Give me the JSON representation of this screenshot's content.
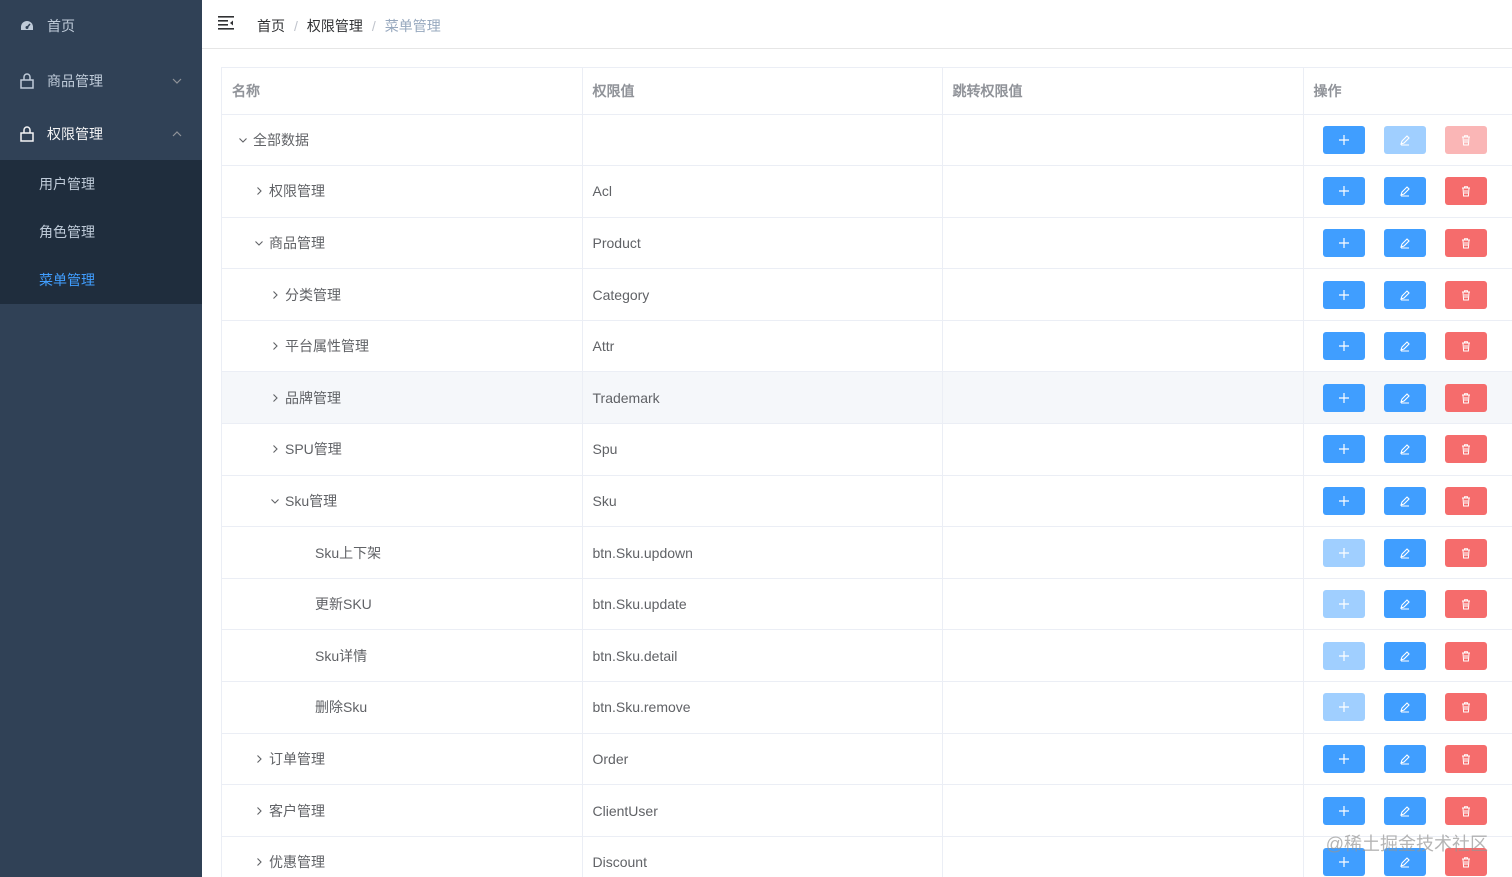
{
  "sidebar": {
    "items": [
      {
        "label": "首页",
        "icon": "dashboard-icon"
      },
      {
        "label": "商品管理",
        "icon": "lock-icon",
        "expanded": false
      },
      {
        "label": "权限管理",
        "icon": "lock-icon",
        "expanded": true
      }
    ],
    "submenu": [
      {
        "label": "用户管理",
        "active": false
      },
      {
        "label": "角色管理",
        "active": false
      },
      {
        "label": "菜单管理",
        "active": true
      }
    ],
    "colors": {
      "bg": "#304156",
      "sub_bg": "#1f2d3d",
      "text": "#bfcbd9",
      "active": "#409eff"
    }
  },
  "header": {
    "breadcrumb": [
      "首页",
      "权限管理",
      "菜单管理"
    ]
  },
  "table": {
    "columns": [
      "名称",
      "权限值",
      "跳转权限值",
      "操作"
    ],
    "rows": [
      {
        "name": "全部数据",
        "code": "",
        "toCode": "",
        "level": 0,
        "expand": "open",
        "addDisabled": false,
        "editDisabled": true,
        "delDisabled": true
      },
      {
        "name": "权限管理",
        "code": "Acl",
        "toCode": "",
        "level": 1,
        "expand": "closed",
        "addDisabled": false,
        "editDisabled": false,
        "delDisabled": false
      },
      {
        "name": "商品管理",
        "code": "Product",
        "toCode": "",
        "level": 1,
        "expand": "open",
        "addDisabled": false,
        "editDisabled": false,
        "delDisabled": false
      },
      {
        "name": "分类管理",
        "code": "Category",
        "toCode": "",
        "level": 2,
        "expand": "closed",
        "addDisabled": false,
        "editDisabled": false,
        "delDisabled": false
      },
      {
        "name": "平台属性管理",
        "code": "Attr",
        "toCode": "",
        "level": 2,
        "expand": "closed",
        "addDisabled": false,
        "editDisabled": false,
        "delDisabled": false
      },
      {
        "name": "品牌管理",
        "code": "Trademark",
        "toCode": "",
        "level": 2,
        "expand": "closed",
        "addDisabled": false,
        "editDisabled": false,
        "delDisabled": false,
        "hover": true
      },
      {
        "name": "SPU管理",
        "code": "Spu",
        "toCode": "",
        "level": 2,
        "expand": "closed",
        "addDisabled": false,
        "editDisabled": false,
        "delDisabled": false
      },
      {
        "name": "Sku管理",
        "code": "Sku",
        "toCode": "",
        "level": 2,
        "expand": "open",
        "addDisabled": false,
        "editDisabled": false,
        "delDisabled": false
      },
      {
        "name": "Sku上下架",
        "code": "btn.Sku.updown",
        "toCode": "",
        "level": 3,
        "expand": "none",
        "addDisabled": true,
        "editDisabled": false,
        "delDisabled": false
      },
      {
        "name": "更新SKU",
        "code": "btn.Sku.update",
        "toCode": "",
        "level": 3,
        "expand": "none",
        "addDisabled": true,
        "editDisabled": false,
        "delDisabled": false
      },
      {
        "name": "Sku详情",
        "code": "btn.Sku.detail",
        "toCode": "",
        "level": 3,
        "expand": "none",
        "addDisabled": true,
        "editDisabled": false,
        "delDisabled": false
      },
      {
        "name": "删除Sku",
        "code": "btn.Sku.remove",
        "toCode": "",
        "level": 3,
        "expand": "none",
        "addDisabled": true,
        "editDisabled": false,
        "delDisabled": false
      },
      {
        "name": "订单管理",
        "code": "Order",
        "toCode": "",
        "level": 1,
        "expand": "closed",
        "addDisabled": false,
        "editDisabled": false,
        "delDisabled": false
      },
      {
        "name": "客户管理",
        "code": "ClientUser",
        "toCode": "",
        "level": 1,
        "expand": "closed",
        "addDisabled": false,
        "editDisabled": false,
        "delDisabled": false
      },
      {
        "name": "优惠管理",
        "code": "Discount",
        "toCode": "",
        "level": 1,
        "expand": "closed",
        "addDisabled": false,
        "editDisabled": false,
        "delDisabled": false
      }
    ]
  },
  "watermark": "@稀土掘金技术社区",
  "colors": {
    "primary": "#409eff",
    "danger": "#f56c6c",
    "primary_disabled": "#a0cfff",
    "danger_disabled": "#fab6b6"
  }
}
